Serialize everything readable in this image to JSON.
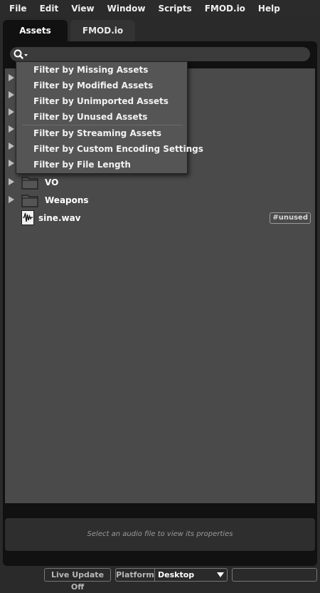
{
  "menubar": [
    "File",
    "Edit",
    "View",
    "Window",
    "Scripts",
    "FMOD.io",
    "Help"
  ],
  "tabs": {
    "assets": "Assets",
    "fmodio": "FMOD.io"
  },
  "search": {
    "placeholder": "",
    "icon": "search-icon"
  },
  "filter_menu": [
    "Filter by Missing Assets",
    "Filter by Modified Assets",
    "Filter by Unimported Assets",
    "Filter by Unused Assets",
    "Filter by Streaming Assets",
    "Filter by Custom Encoding Settings",
    "Filter by File Length"
  ],
  "tree": {
    "folders": [
      "VO",
      "Weapons"
    ],
    "file": {
      "name": "sine.wav",
      "badge": "#unused"
    }
  },
  "properties": {
    "hint": "Select an audio file to view its properties"
  },
  "status": {
    "live_update": "Live Update Off",
    "platform_label": "Platform",
    "platform_value": "Desktop"
  },
  "colors": {
    "background": "#2a2a2a",
    "panel": "#111111",
    "list": "#4a4a4a",
    "menu": "#555555"
  }
}
